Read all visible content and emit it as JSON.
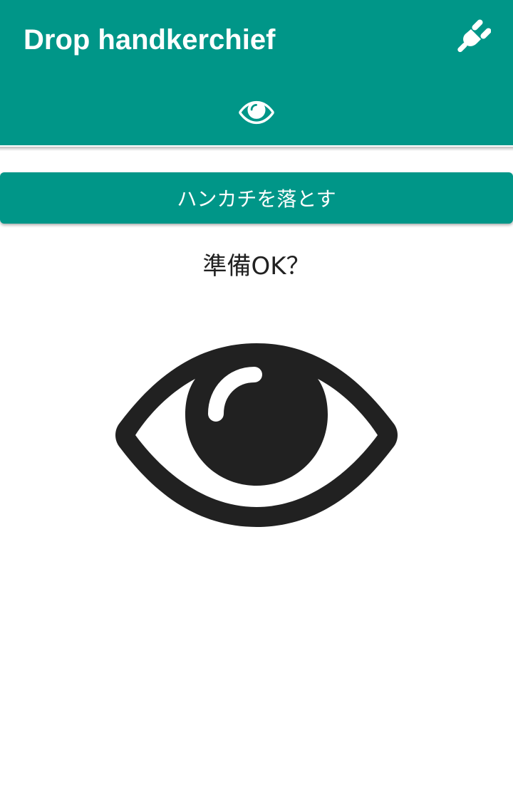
{
  "appbar": {
    "title": "Drop handkerchief",
    "action_icon": "power-plug-icon"
  },
  "tabs": [
    {
      "icon": "eye-icon",
      "selected": true
    }
  ],
  "main": {
    "drop_button_label": "ハンカチを落とす",
    "status_text": "準備OK？",
    "status_icon": "eye-icon"
  },
  "colors": {
    "primary": "#009688",
    "on_primary": "#ffffff",
    "text_dark": "#212121"
  }
}
